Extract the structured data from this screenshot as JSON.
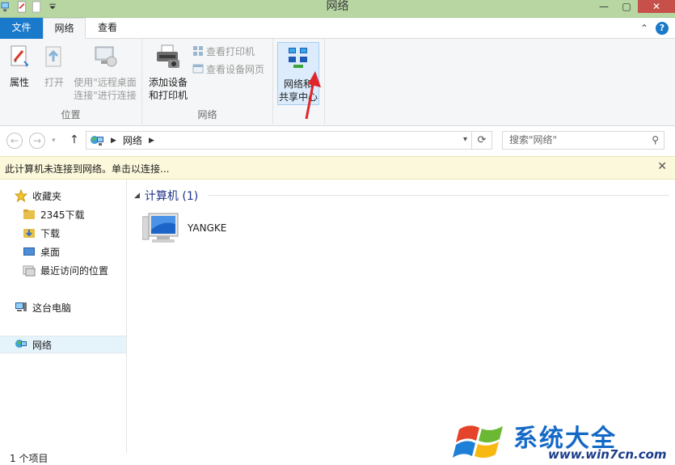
{
  "window": {
    "title": "网络"
  },
  "ribbon_tabs": {
    "file": "文件",
    "network": "网络",
    "view": "查看"
  },
  "groups": {
    "location": {
      "label": "位置",
      "properties": "属性",
      "open": "打开",
      "remote_line1": "使用\"远程桌面",
      "remote_line2": "连接\"进行连接"
    },
    "network": {
      "label": "网络",
      "add_line1": "添加设备",
      "add_line2": "和打印机",
      "view_printers": "查看打印机",
      "view_device_webpage": "查看设备网页"
    },
    "center": {
      "line1": "网络和",
      "line2": "共享中心"
    }
  },
  "address": {
    "crumb": "网络"
  },
  "search": {
    "placeholder": "搜索\"网络\""
  },
  "infobar": {
    "message": "此计算机未连接到网络。单击以连接..."
  },
  "nav": {
    "favorites": "收藏夹",
    "items": [
      "2345下载",
      "下载",
      "桌面",
      "最近访问的位置"
    ],
    "this_pc": "这台电脑",
    "network": "网络"
  },
  "content": {
    "group_header": "计算机 (1)",
    "computers": [
      "YANGKE"
    ]
  },
  "status": {
    "count": "1 个项目"
  },
  "watermark": {
    "title": "系统大全",
    "url": "www.win7cn.com"
  },
  "colors": {
    "titlebar": "#b7d6a2",
    "file_tab": "#1979ca",
    "infobar": "#fcf8db",
    "arrow": "#e2252b"
  }
}
